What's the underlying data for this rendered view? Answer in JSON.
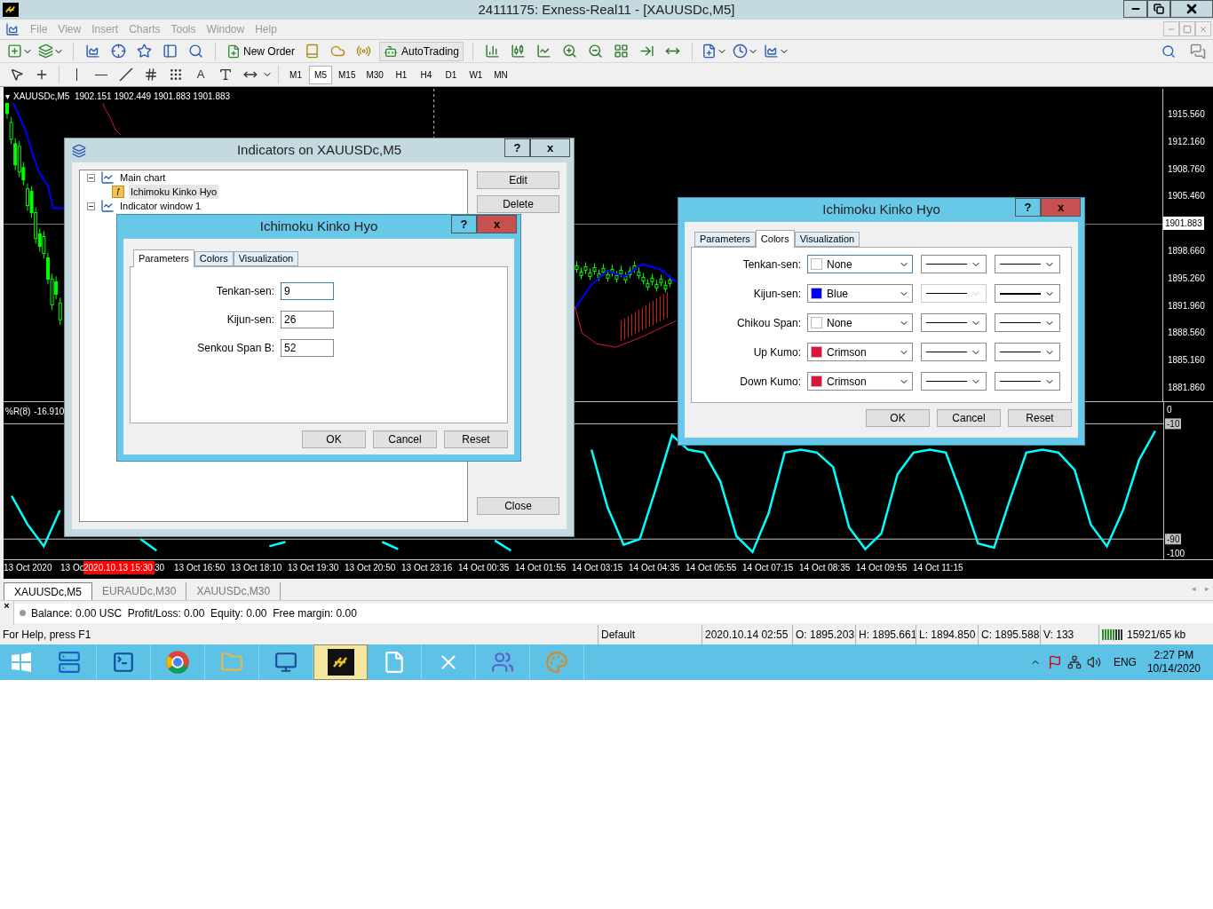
{
  "window": {
    "title": "24111175: Exness-Real11 - [XAUUSDc,M5]"
  },
  "menu": [
    "File",
    "View",
    "Insert",
    "Charts",
    "Tools",
    "Window",
    "Help"
  ],
  "toolbar": {
    "new_order": "New Order",
    "auto_trading": "AutoTrading",
    "text_tool": "A"
  },
  "timeframes": [
    {
      "label": "M1",
      "selected": false
    },
    {
      "label": "M5",
      "selected": true
    },
    {
      "label": "M15",
      "selected": false
    },
    {
      "label": "M30",
      "selected": false
    },
    {
      "label": "H1",
      "selected": false
    },
    {
      "label": "H4",
      "selected": false
    },
    {
      "label": "D1",
      "selected": false
    },
    {
      "label": "W1",
      "selected": false
    },
    {
      "label": "MN",
      "selected": false
    }
  ],
  "chart": {
    "header_marker": "▾",
    "header": "XAUUSDc,M5  1902.151 1902.449 1901.883 1901.883",
    "oscillator": {
      "chart_data": {
        "type": "line",
        "ylim": [
          -104,
          5
        ],
        "yticks": [
          0,
          -10,
          -90,
          -100
        ],
        "series": [
          {
            "name": "%R(8)",
            "color": "#00ffff",
            "values": [
              -60,
              -80,
              -95,
              -70,
              null,
              null,
              null,
              null,
              -90,
              -98,
              null,
              null,
              null,
              null,
              null,
              null,
              -95,
              -92,
              null,
              null,
              null,
              null,
              null,
              -92,
              -97,
              null,
              null,
              null,
              null,
              null,
              -91,
              -98,
              null,
              null,
              null,
              null,
              -28,
              -68,
              -94,
              -90,
              -55,
              -18,
              -28,
              -30,
              -50,
              -88,
              -99,
              -72,
              -30,
              -28,
              -30,
              -40,
              -82,
              -97,
              -86,
              -45,
              -30,
              -28,
              -30,
              -60,
              -93,
              -96,
              -62,
              -30,
              -28,
              -30,
              -42,
              -80,
              -95,
              -70,
              -35,
              -15
            ]
          }
        ]
      }
    },
    "price_axis": [
      {
        "kind": "tick",
        "label": "1915.560"
      },
      {
        "kind": "tick",
        "label": "1912.160"
      },
      {
        "kind": "tick",
        "label": "1908.760"
      },
      {
        "kind": "tick",
        "label": "1905.460"
      },
      {
        "kind": "current",
        "label": "1901.883"
      },
      {
        "kind": "tick",
        "label": "1898.660"
      },
      {
        "kind": "tick",
        "label": "1895.260"
      },
      {
        "kind": "tick",
        "label": "1891.960"
      },
      {
        "kind": "tick",
        "label": "1888.560"
      },
      {
        "kind": "tick",
        "label": "1885.160"
      },
      {
        "kind": "tick",
        "label": "1881.860"
      }
    ],
    "indicator_reading": "-16.910",
    "time_axis": [
      {
        "kind": "tick",
        "label": "13 Oct 2020"
      },
      {
        "kind": "part",
        "label": "13 Oc"
      },
      {
        "kind": "cursor",
        "label": "2020.10.13 15:30"
      },
      {
        "kind": "part",
        "label": "30"
      },
      {
        "kind": "tick",
        "label": "13 Oct 16:50"
      },
      {
        "kind": "tick",
        "label": "13 Oct 18:10"
      },
      {
        "kind": "tick",
        "label": "13 Oct 19:30"
      },
      {
        "kind": "tick",
        "label": "13 Oct 20:50"
      },
      {
        "kind": "tick",
        "label": "13 Oct 23:16"
      },
      {
        "kind": "tick",
        "label": "14 Oct 00:35"
      },
      {
        "kind": "tick",
        "label": "14 Oct 01:55"
      },
      {
        "kind": "tick",
        "label": "14 Oct 03:15"
      },
      {
        "kind": "tick",
        "label": "14 Oct 04:35"
      },
      {
        "kind": "tick",
        "label": "14 Oct 05:55"
      },
      {
        "kind": "tick",
        "label": "14 Oct 07:15"
      },
      {
        "kind": "tick",
        "label": "14 Oct 08:35"
      },
      {
        "kind": "tick",
        "label": "14 Oct 09:55"
      },
      {
        "kind": "tick",
        "label": "14 Oct 11:15"
      }
    ]
  },
  "indicators_dialog": {
    "title": "Indicators on XAUUSDc,M5",
    "help": "?",
    "close": "x",
    "tree": [
      {
        "label": "Main chart",
        "expanded": true,
        "children": [
          {
            "label": "Ichimoku Kinko Hyo",
            "badge": "ƒ",
            "selected": true
          }
        ]
      },
      {
        "label": "Indicator window 1",
        "expanded": true
      }
    ],
    "buttons": [
      "Edit",
      "Delete",
      "Close"
    ]
  },
  "parameters_dialog": {
    "title": "Ichimoku Kinko Hyo",
    "help": "?",
    "close": "x",
    "tabs": [
      {
        "label": "Parameters",
        "selected": true
      },
      {
        "label": "Colors",
        "selected": false
      },
      {
        "label": "Visualization",
        "selected": false
      }
    ],
    "fields": [
      {
        "label": "Tenkan-sen:",
        "value": "9"
      },
      {
        "label": "Kijun-sen:",
        "value": "26"
      },
      {
        "label": "Senkou Span B:",
        "value": "52"
      }
    ],
    "buttons": [
      "OK",
      "Cancel",
      "Reset"
    ]
  },
  "colors_dialog": {
    "title": "Ichimoku Kinko Hyo",
    "help": "?",
    "close": "x",
    "tabs": [
      {
        "label": "Parameters",
        "selected": false
      },
      {
        "label": "Colors",
        "selected": true
      },
      {
        "label": "Visualization",
        "selected": false
      }
    ],
    "rows": [
      {
        "label": "Tenkan-sen:",
        "color_name": "None",
        "color": "#ffffff",
        "style_disabled": false,
        "thick": false
      },
      {
        "label": "Kijun-sen:",
        "color_name": "Blue",
        "color": "#0000ff",
        "style_disabled": true,
        "thick": true
      },
      {
        "label": "Chikou Span:",
        "color_name": "None",
        "color": "#ffffff",
        "style_disabled": false,
        "thick": false
      },
      {
        "label": "Up Kumo:",
        "color_name": "Crimson",
        "color": "#dc143c",
        "style_disabled": false,
        "thick": false
      },
      {
        "label": "Down Kumo:",
        "color_name": "Crimson",
        "color": "#dc143c",
        "style_disabled": false,
        "thick": false
      }
    ],
    "buttons": [
      "OK",
      "Cancel",
      "Reset"
    ]
  },
  "tab_scroll": [
    "◂",
    "▸"
  ],
  "chart_tabs": [
    {
      "label": "XAUUSDc,M5",
      "selected": true
    },
    {
      "label": "EURAUDc,M30",
      "selected": false
    },
    {
      "label": "XAUUSDc,M30",
      "selected": false
    }
  ],
  "terminal": {
    "close": "×",
    "account": "Balance: 0.00 USC  Profit/Loss: 0.00  Equity: 0.00  Free margin: 0.00"
  },
  "status_bar": [
    "For Help, press F1",
    "Default",
    "2020.10.14 02:55",
    "O: 1895.203",
    "H: 1895.661",
    "L: 1894.850",
    "C: 1895.588",
    "V: 133",
    "15921/65 kb"
  ],
  "taskbar": {
    "apps": [
      {
        "active": false
      },
      {
        "active": false
      },
      {
        "active": false
      },
      {
        "active": false
      },
      {
        "active": false
      },
      {
        "active": true
      },
      {
        "active": false
      },
      {
        "active": false
      },
      {
        "active": false
      },
      {
        "active": false
      }
    ],
    "language": "ENG",
    "time": "2:27 PM",
    "date": "10/14/2020"
  }
}
